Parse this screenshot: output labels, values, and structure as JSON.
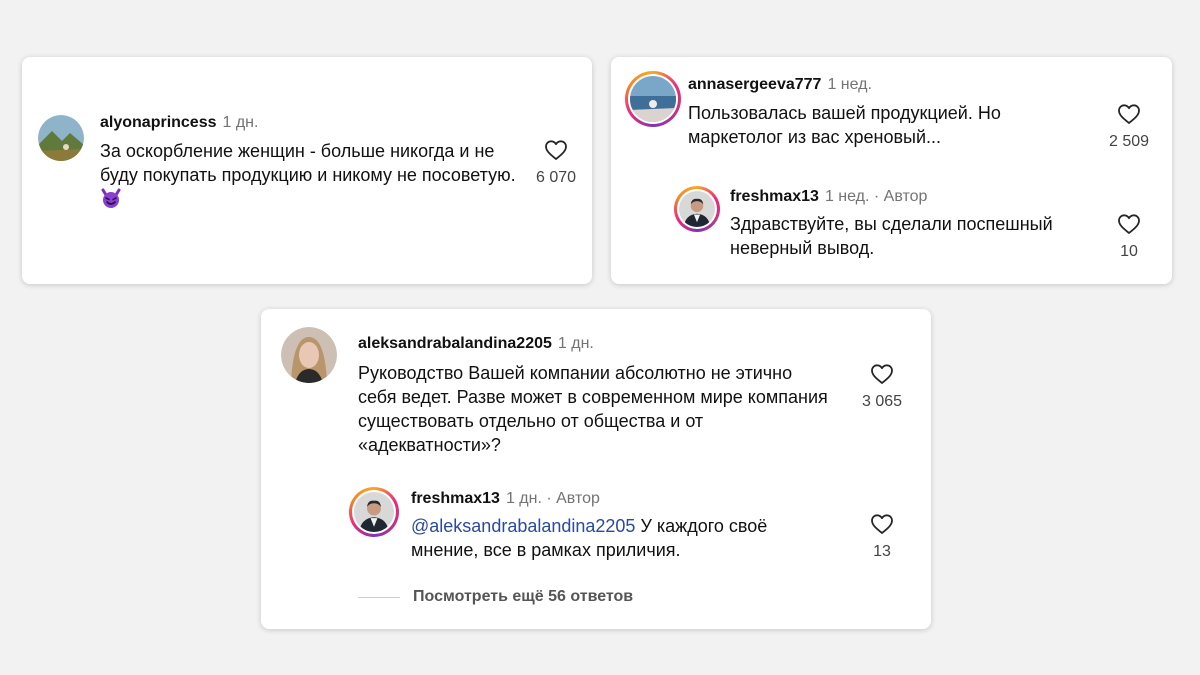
{
  "comments": [
    {
      "user": "alyonaprincess",
      "meta": "1 дн.",
      "text": "За оскорбление женщин - больше никогда и не буду покупать продукцию и никому не посоветую.",
      "emoji": "smiling-imp-emoji",
      "likes": "6 070"
    },
    {
      "user": "annasergeeva777",
      "meta": "1 нед.",
      "text": "Пользовалась вашей продукцией. Но маркетолог из вас хреновый...",
      "likes": "2 509",
      "reply": {
        "user": "freshmax13",
        "meta": "1 нед. · Автор",
        "text": "Здравствуйте, вы сделали поспешный неверный вывод.",
        "likes": "10"
      }
    },
    {
      "user": "aleksandrabalandina2205",
      "meta": "1 дн.",
      "text": "Руководство Вашей компании абсолютно не этично себя ведет. Разве может в современном мире компания существовать отдельно от общества и от «адекватности»?",
      "likes": "3 065",
      "reply": {
        "user": "freshmax13",
        "meta": "1 дн. · Автор",
        "mention": "@aleksandrabalandina2205",
        "text": " У каждого своё мнение, все в рамках приличия.",
        "likes": "13"
      },
      "more_replies": "Посмотреть ещё 56 ответов"
    }
  ],
  "colors": {
    "background": "#f2f2f2",
    "mention": "#2b4a9a",
    "meta": "#737373"
  }
}
